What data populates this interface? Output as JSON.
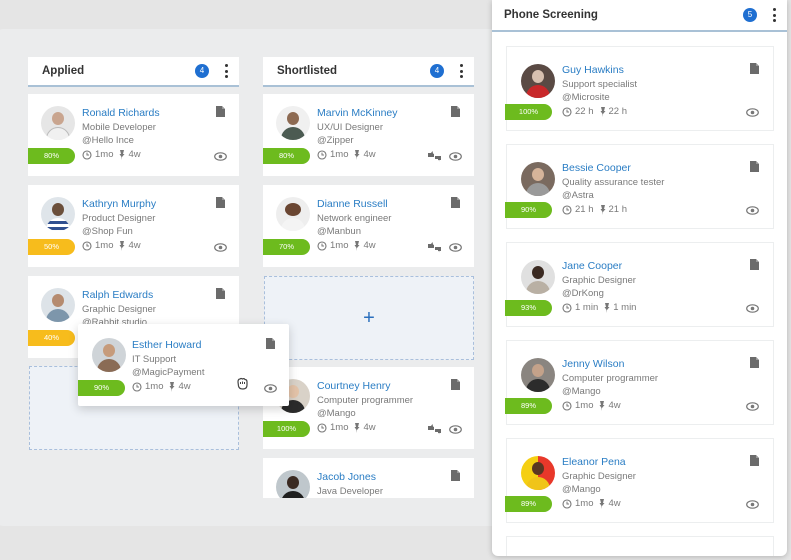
{
  "colors": {
    "accent": "#2a7dc4",
    "badge": "#1f6fd1",
    "progress_green": "#6dbb1e",
    "progress_yellow": "#f7bc1c"
  },
  "columns": [
    {
      "title": "Applied",
      "count": "4",
      "cards": [
        {
          "name": "Ronald Richards",
          "role": "Mobile Developer",
          "company": "@Hello Ince",
          "progress": "80%",
          "progress_color": "green",
          "time": "1mo",
          "pinned": "4w"
        },
        {
          "name": "Kathryn Murphy",
          "role": "Product Designer",
          "company": "@Shop Fun",
          "progress": "50%",
          "progress_color": "yellow",
          "time": "1mo",
          "pinned": "4w"
        },
        {
          "name": "Ralph Edwards",
          "role": "Graphic Designer",
          "company": "@Rabbit studio",
          "progress": "40%",
          "progress_color": "yellow",
          "time": "",
          "pinned": ""
        }
      ]
    },
    {
      "title": "Shortlisted",
      "count": "4",
      "add_label": "+",
      "cards": [
        {
          "name": "Marvin McKinney",
          "role": "UX/UI Designer",
          "company": "@Zipper",
          "progress": "80%",
          "progress_color": "green",
          "time": "1mo",
          "pinned": "4w"
        },
        {
          "name": "Dianne Russell",
          "role": "Network engineer",
          "company": "@Manbun",
          "progress": "70%",
          "progress_color": "green",
          "time": "1mo",
          "pinned": "4w"
        },
        {
          "name": "Courtney Henry",
          "role": "Computer programmer",
          "company": "@Mango",
          "progress": "100%",
          "progress_color": "green",
          "time": "1mo",
          "pinned": "4w"
        },
        {
          "name": "Jacob Jones",
          "role": "Java Developer",
          "company": "",
          "progress": "",
          "progress_color": "",
          "time": "",
          "pinned": ""
        }
      ]
    },
    {
      "title": "Phone Screening",
      "count": "5",
      "cards": [
        {
          "name": "Guy Hawkins",
          "role": "Support specialist",
          "company": "@Microsite",
          "progress": "100%",
          "progress_color": "green",
          "time": "22 h",
          "pinned": "22 h"
        },
        {
          "name": "Bessie Cooper",
          "role": "Quality assurance tester",
          "company": "@Astra",
          "progress": "90%",
          "progress_color": "green",
          "time": "21 h",
          "pinned": "21 h"
        },
        {
          "name": "Jane Cooper",
          "role": "Graphic Designer",
          "company": "@DrKong",
          "progress": "93%",
          "progress_color": "green",
          "time": "1 min",
          "pinned": "1 min"
        },
        {
          "name": "Jenny Wilson",
          "role": "Computer programmer",
          "company": "@Mango",
          "progress": "89%",
          "progress_color": "green",
          "time": "1mo",
          "pinned": "4w"
        },
        {
          "name": "Eleanor Pena",
          "role": "Graphic Designer",
          "company": "@Mango",
          "progress": "89%",
          "progress_color": "green",
          "time": "1mo",
          "pinned": "4w"
        }
      ]
    }
  ],
  "dragging_card": {
    "name": "Esther Howard",
    "role": "IT Support",
    "company": "@MagicPayment",
    "progress": "90%",
    "progress_color": "green",
    "time": "1mo",
    "pinned": "4w"
  }
}
